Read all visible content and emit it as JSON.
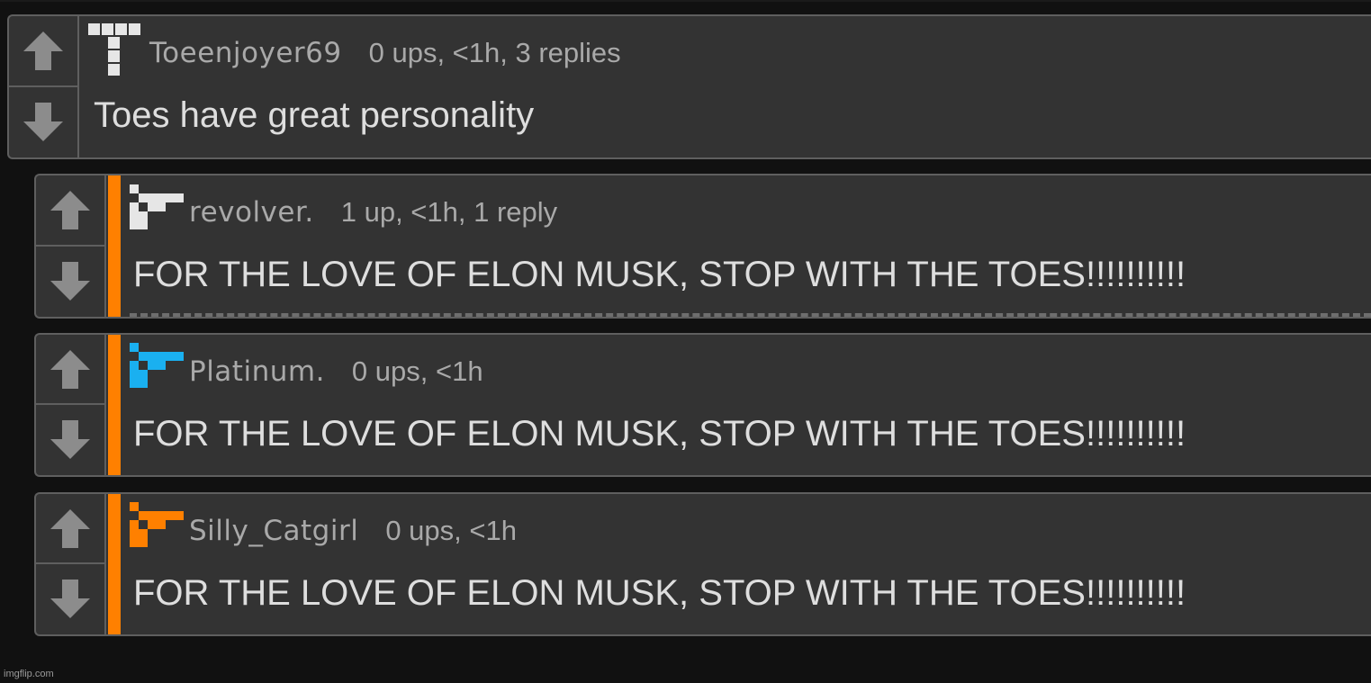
{
  "colors": {
    "background": "#111111",
    "card": "#333333",
    "card_border": "#5f5f5f",
    "reply_accent": "#ff8000",
    "avatar_white": "#e6e6e6",
    "avatar_blue": "#1ab0f0",
    "avatar_orange": "#ff8000"
  },
  "comments": [
    {
      "username": "Toeenjoyer69",
      "meta": "0 ups, <1h, 3 replies",
      "text": "Toes have great personality",
      "avatar_icon": "pixel-avatar-icon-white"
    },
    {
      "username": "revolver.",
      "meta": "1 up, <1h, 1 reply",
      "text": "FOR THE LOVE OF ELON MUSK, STOP WITH THE TOES!!!!!!!!!!",
      "avatar_icon": "pixel-avatar-icon-white"
    },
    {
      "username": "Platinum.",
      "meta": "0 ups, <1h",
      "text": "FOR THE LOVE OF ELON MUSK, STOP WITH THE TOES!!!!!!!!!!",
      "avatar_icon": "pixel-avatar-icon-blue"
    },
    {
      "username": "Silly_Catgirl",
      "meta": "0 ups, <1h",
      "text": "FOR THE LOVE OF ELON MUSK, STOP WITH THE TOES!!!!!!!!!!",
      "avatar_icon": "pixel-avatar-icon-orange"
    }
  ],
  "icons": {
    "upvote": "upvote-arrow-icon",
    "downvote": "downvote-arrow-icon"
  },
  "watermark": "imgflip.com"
}
